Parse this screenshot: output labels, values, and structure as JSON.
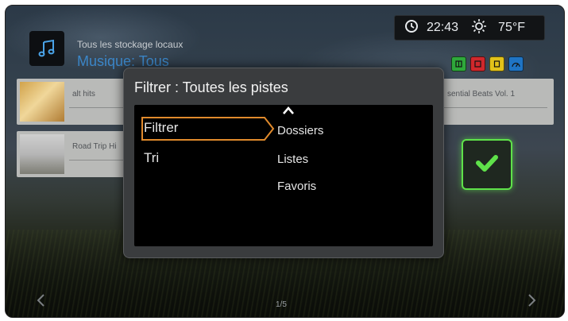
{
  "header": {
    "breadcrumb": "Tous les stockage locaux",
    "title": "Musique: Tous",
    "time": "22:43",
    "temperature": "75°F",
    "color_buttons": [
      {
        "name": "green",
        "color": "#2fa83b"
      },
      {
        "name": "red",
        "color": "#d0282c"
      },
      {
        "name": "yellow",
        "color": "#e2c21a"
      },
      {
        "name": "blue",
        "color": "#1f74c4"
      }
    ]
  },
  "list": {
    "left_items": [
      {
        "label": "alt hits"
      },
      {
        "label": "Road Trip Hi"
      }
    ],
    "right_items": [
      {
        "label": "sential Beats Vol. 1"
      }
    ]
  },
  "dialog": {
    "title": "Filtrer : Toutes les pistes",
    "left_menu": [
      {
        "label": "Filtrer",
        "selected": true
      },
      {
        "label": "Tri",
        "selected": false
      }
    ],
    "right_menu": [
      {
        "label": "Dossiers"
      },
      {
        "label": "Listes"
      },
      {
        "label": "Favoris"
      }
    ]
  },
  "footer": {
    "page_indicator": "1/5"
  },
  "colors": {
    "accent_blue": "#3b86c8",
    "selection_orange": "#e08a2c",
    "confirm_green": "#5fe24a"
  }
}
